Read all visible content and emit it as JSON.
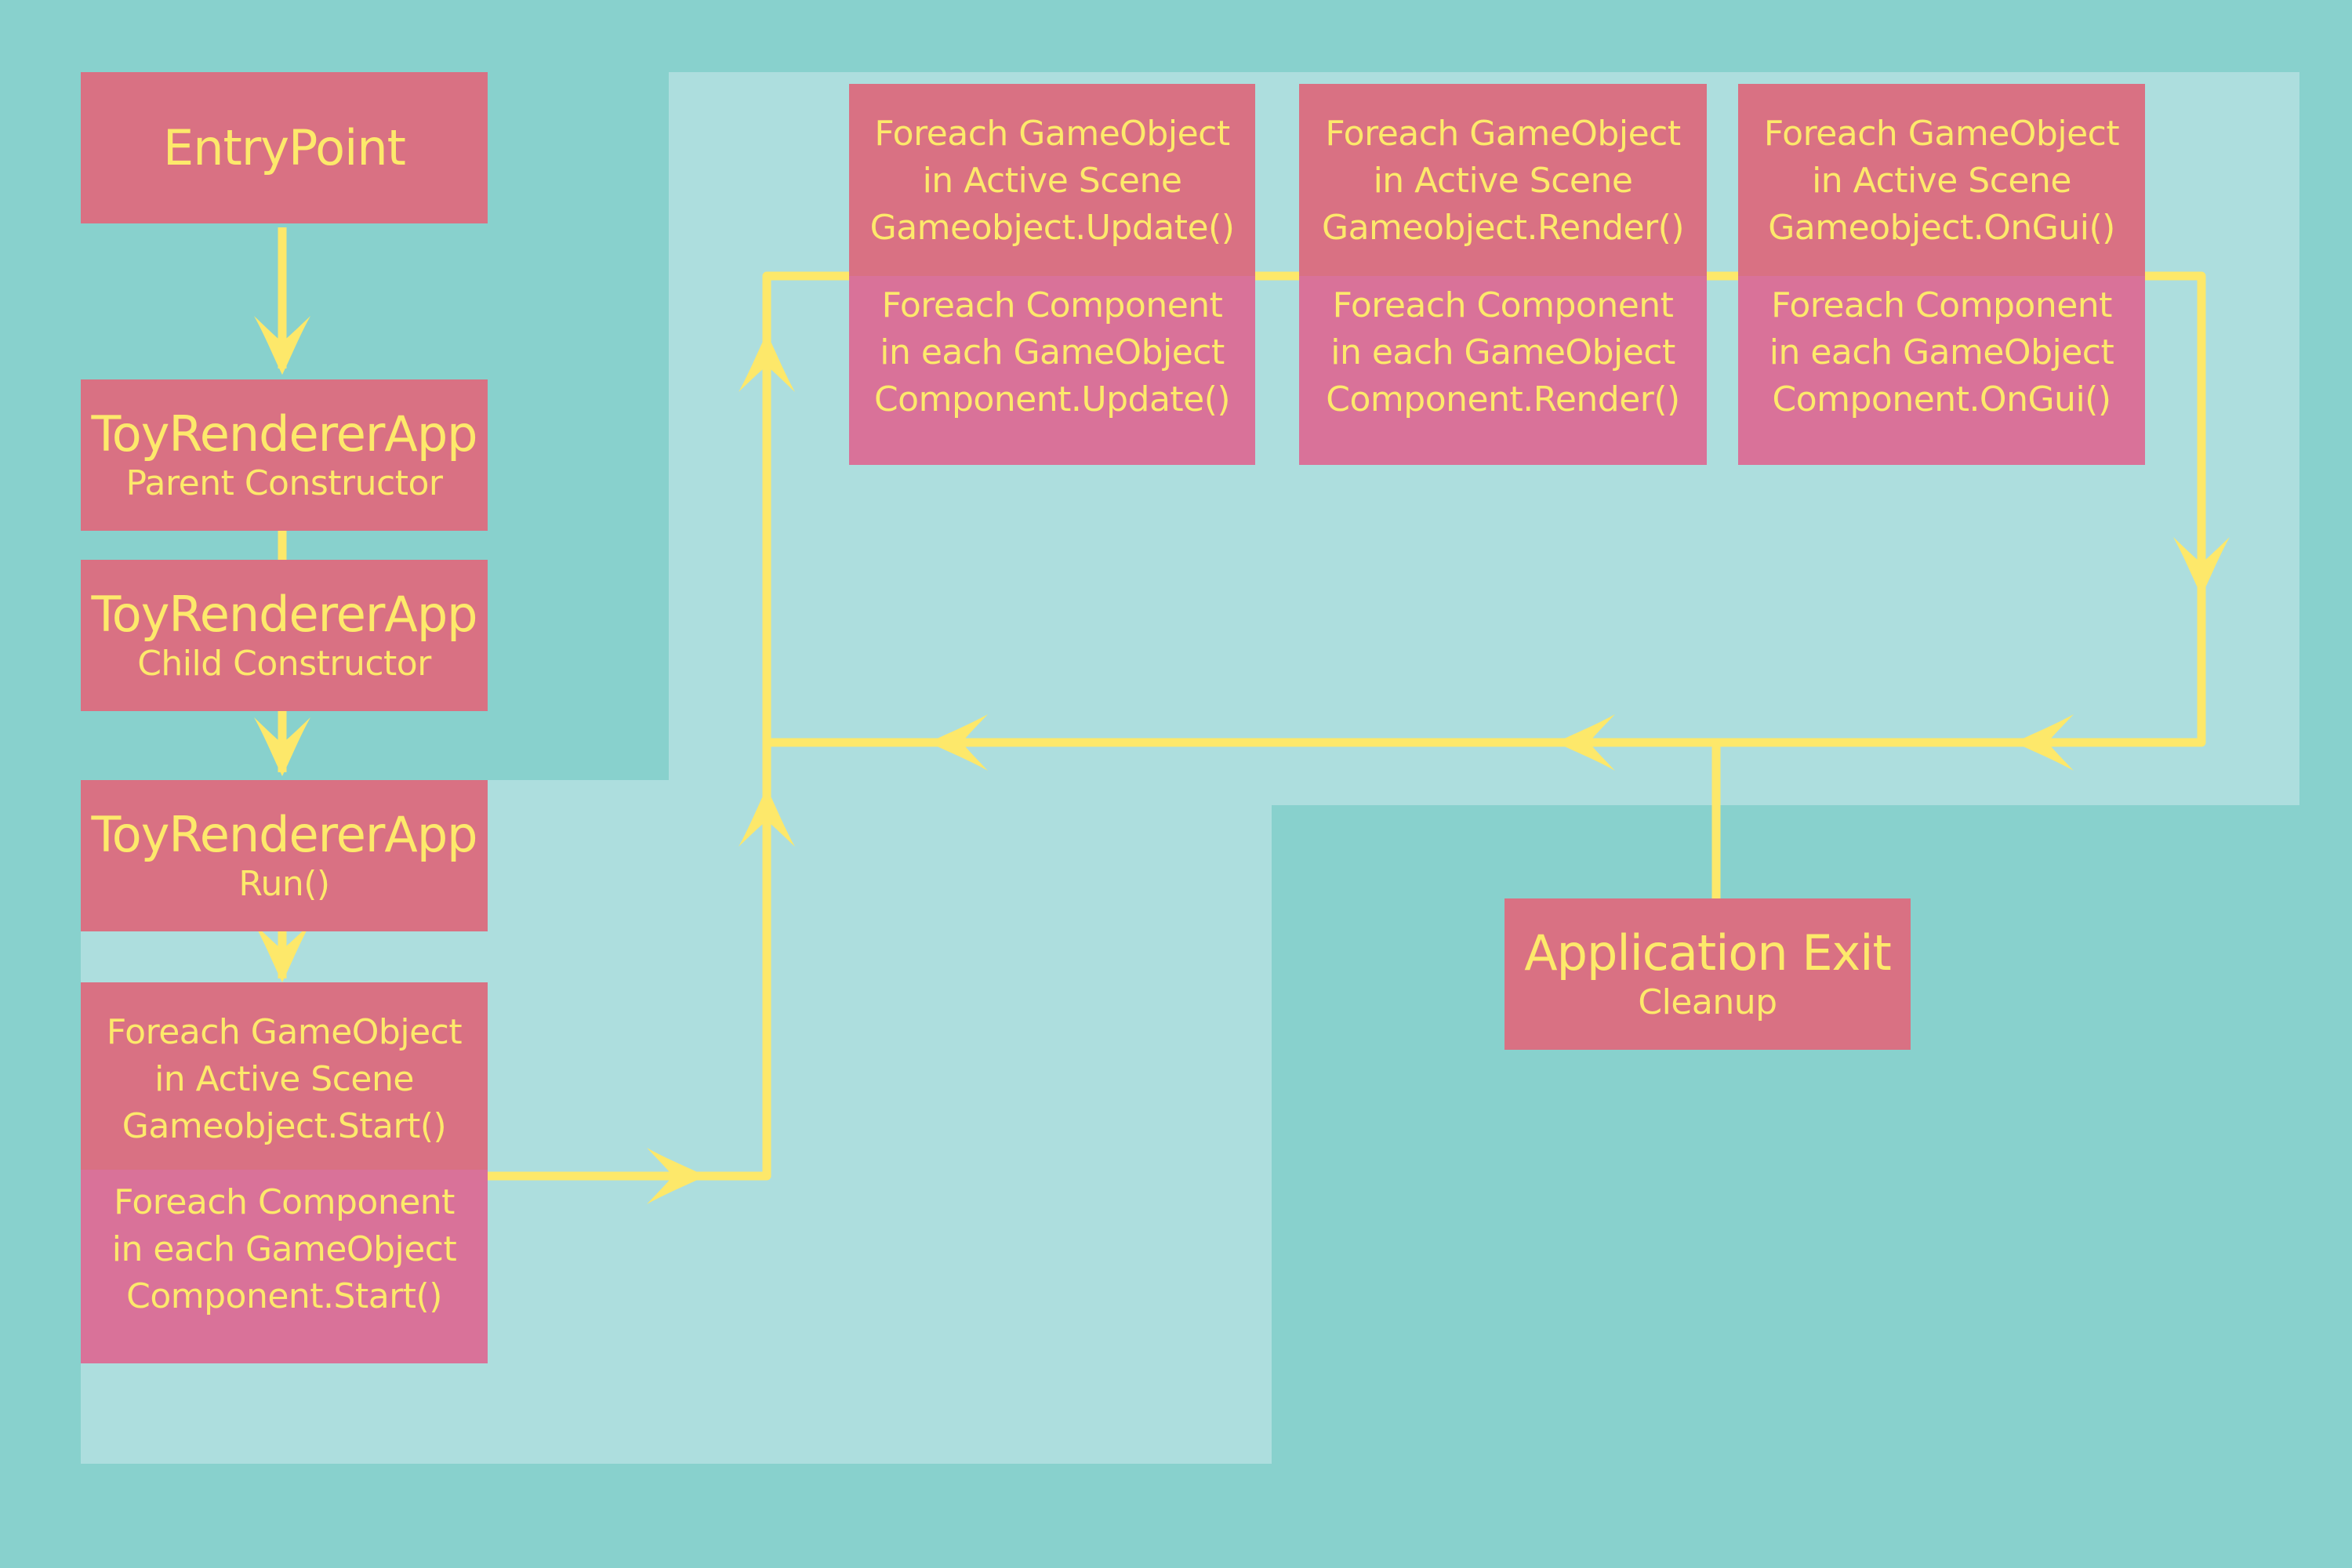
{
  "colors": {
    "background": "#88d1cd",
    "loop_region": "#addede",
    "box_red": "#d97183",
    "box_pink": "#d97299",
    "text": "#fde96b",
    "connector": "#fde86a"
  },
  "nodes": {
    "entry": {
      "title": "EntryPoint"
    },
    "parent_ctor": {
      "title": "ToyRendererApp",
      "subtitle": "Parent Constructor"
    },
    "child_ctor": {
      "title": "ToyRendererApp",
      "subtitle": "Child Constructor"
    },
    "run": {
      "title": "ToyRendererApp",
      "subtitle": "Run()"
    },
    "start": {
      "top": [
        "Foreach GameObject",
        "in Active Scene",
        "Gameobject.Start()"
      ],
      "bottom": [
        "Foreach Component",
        "in each GameObject",
        "Component.Start()"
      ]
    },
    "update": {
      "top": [
        "Foreach GameObject",
        "in Active Scene",
        "Gameobject.Update()"
      ],
      "bottom": [
        "Foreach Component",
        "in each GameObject",
        "Component.Update()"
      ]
    },
    "render": {
      "top": [
        "Foreach GameObject",
        "in Active Scene",
        "Gameobject.Render()"
      ],
      "bottom": [
        "Foreach Component",
        "in each GameObject",
        "Component.Render()"
      ]
    },
    "ongui": {
      "top": [
        "Foreach GameObject",
        "in Active Scene",
        "Gameobject.OnGui()"
      ],
      "bottom": [
        "Foreach Component",
        "in each GameObject",
        "Component.OnGui()"
      ]
    },
    "exit": {
      "title": "Application Exit",
      "subtitle": "Cleanup"
    }
  },
  "edges": [
    {
      "from": "entry",
      "to": "parent_ctor"
    },
    {
      "from": "parent_ctor",
      "to": "child_ctor"
    },
    {
      "from": "child_ctor",
      "to": "run"
    },
    {
      "from": "run",
      "to": "start"
    },
    {
      "from": "start",
      "to": "update"
    },
    {
      "from": "update",
      "to": "render"
    },
    {
      "from": "render",
      "to": "ongui"
    },
    {
      "from": "ongui",
      "to": "update"
    },
    {
      "from": "ongui",
      "to": "exit"
    }
  ]
}
